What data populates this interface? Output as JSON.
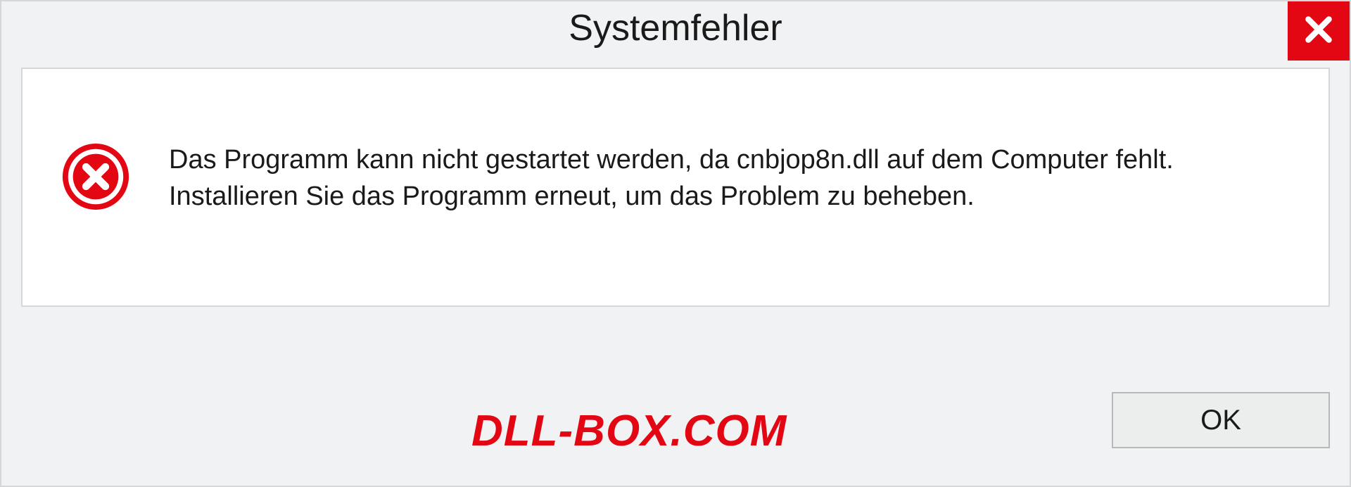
{
  "dialog": {
    "title": "Systemfehler",
    "message": "Das Programm kann nicht gestartet werden, da cnbjop8n.dll auf dem Computer fehlt. Installieren Sie das Programm erneut, um das Problem zu beheben.",
    "ok_label": "OK"
  },
  "watermark": "DLL-BOX.COM",
  "colors": {
    "accent_red": "#e30613",
    "panel_bg": "#f1f2f3",
    "border": "#d6d7d8"
  }
}
